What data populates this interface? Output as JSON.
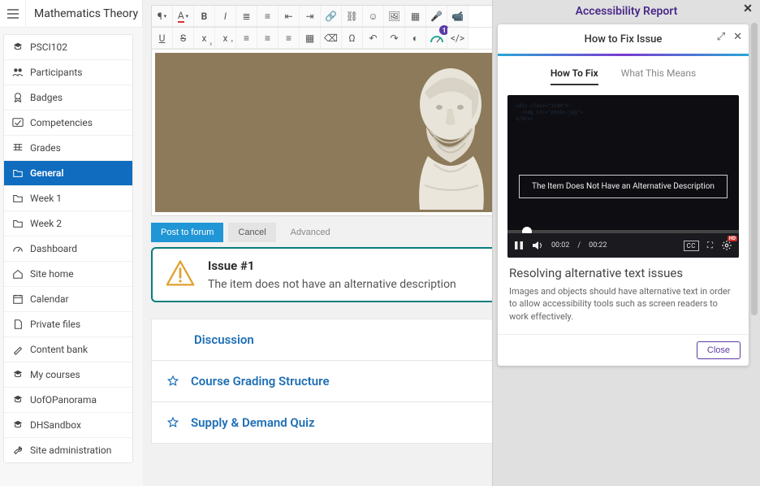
{
  "header": {
    "title": "Mathematics Theory"
  },
  "sidebar": {
    "items": [
      {
        "label": "PSCI102",
        "icon": "graduation"
      },
      {
        "label": "Participants",
        "icon": "users"
      },
      {
        "label": "Badges",
        "icon": "badge"
      },
      {
        "label": "Competencies",
        "icon": "check"
      },
      {
        "label": "Grades",
        "icon": "grid"
      },
      {
        "label": "General",
        "icon": "folder",
        "active": true
      },
      {
        "label": "Week 1",
        "icon": "folder"
      },
      {
        "label": "Week 2",
        "icon": "folder"
      },
      {
        "label": "Dashboard",
        "icon": "gauge"
      },
      {
        "label": "Site home",
        "icon": "home"
      },
      {
        "label": "Calendar",
        "icon": "calendar"
      },
      {
        "label": "Private files",
        "icon": "file"
      },
      {
        "label": "Content bank",
        "icon": "brush"
      },
      {
        "label": "My courses",
        "icon": "graduation"
      },
      {
        "label": "UofOPanorama",
        "icon": "graduation"
      },
      {
        "label": "DHSandbox",
        "icon": "graduation"
      },
      {
        "label": "Site administration",
        "icon": "wrench"
      }
    ]
  },
  "editor": {
    "buttons": {
      "post": "Post to forum",
      "cancel": "Cancel",
      "advanced": "Advanced"
    },
    "gauge_badge": "1"
  },
  "issue": {
    "title": "Issue #1",
    "desc": "The item does not have an alternative description"
  },
  "course_links": [
    {
      "label": "Discussion"
    },
    {
      "label": "Course Grading Structure"
    },
    {
      "label": "Supply & Demand Quiz"
    }
  ],
  "report": {
    "header": "Accessibility Report",
    "panel_title": "How to Fix Issue",
    "tabs": {
      "howto": "How To Fix",
      "what": "What This Means"
    },
    "video": {
      "caption": "The Item Does Not Have an Alternative Description",
      "time_current": "00:02",
      "time_sep": "/",
      "time_total": "00:22",
      "cc": "CC",
      "hd": "HD"
    },
    "help_heading": "Resolving alternative text issues",
    "help_body": "Images and objects should have alternative text in order to allow accessibility tools such as screen readers to work effectively.",
    "close": "Close"
  }
}
